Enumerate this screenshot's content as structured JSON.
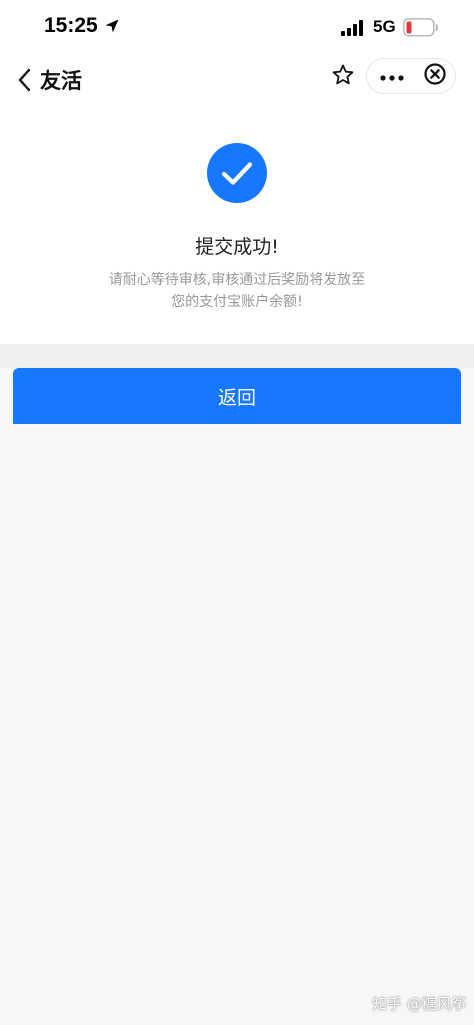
{
  "status_bar": {
    "time": "15:25",
    "network": "5G",
    "location_icon": "location-arrow-icon",
    "signal_icon": "signal-bars-icon",
    "battery_icon": "battery-low-icon",
    "battery_color": "#e53935"
  },
  "nav": {
    "title": "友活",
    "back_icon": "chevron-left-icon",
    "star_icon": "star-outline-icon",
    "more_icon": "more-dots-icon",
    "close_icon": "circle-close-icon"
  },
  "result": {
    "icon": "check-circle-icon",
    "icon_color": "#1677ff",
    "title": "提交成功!",
    "description_line1": "请耐心等待审核,审核通过后奖励将发放至",
    "description_line2": "您的支付宝账户余额!"
  },
  "actions": {
    "return_label": "返回",
    "accent": "#1677ff"
  },
  "watermark": {
    "text": "知乎 @糖风筝"
  }
}
